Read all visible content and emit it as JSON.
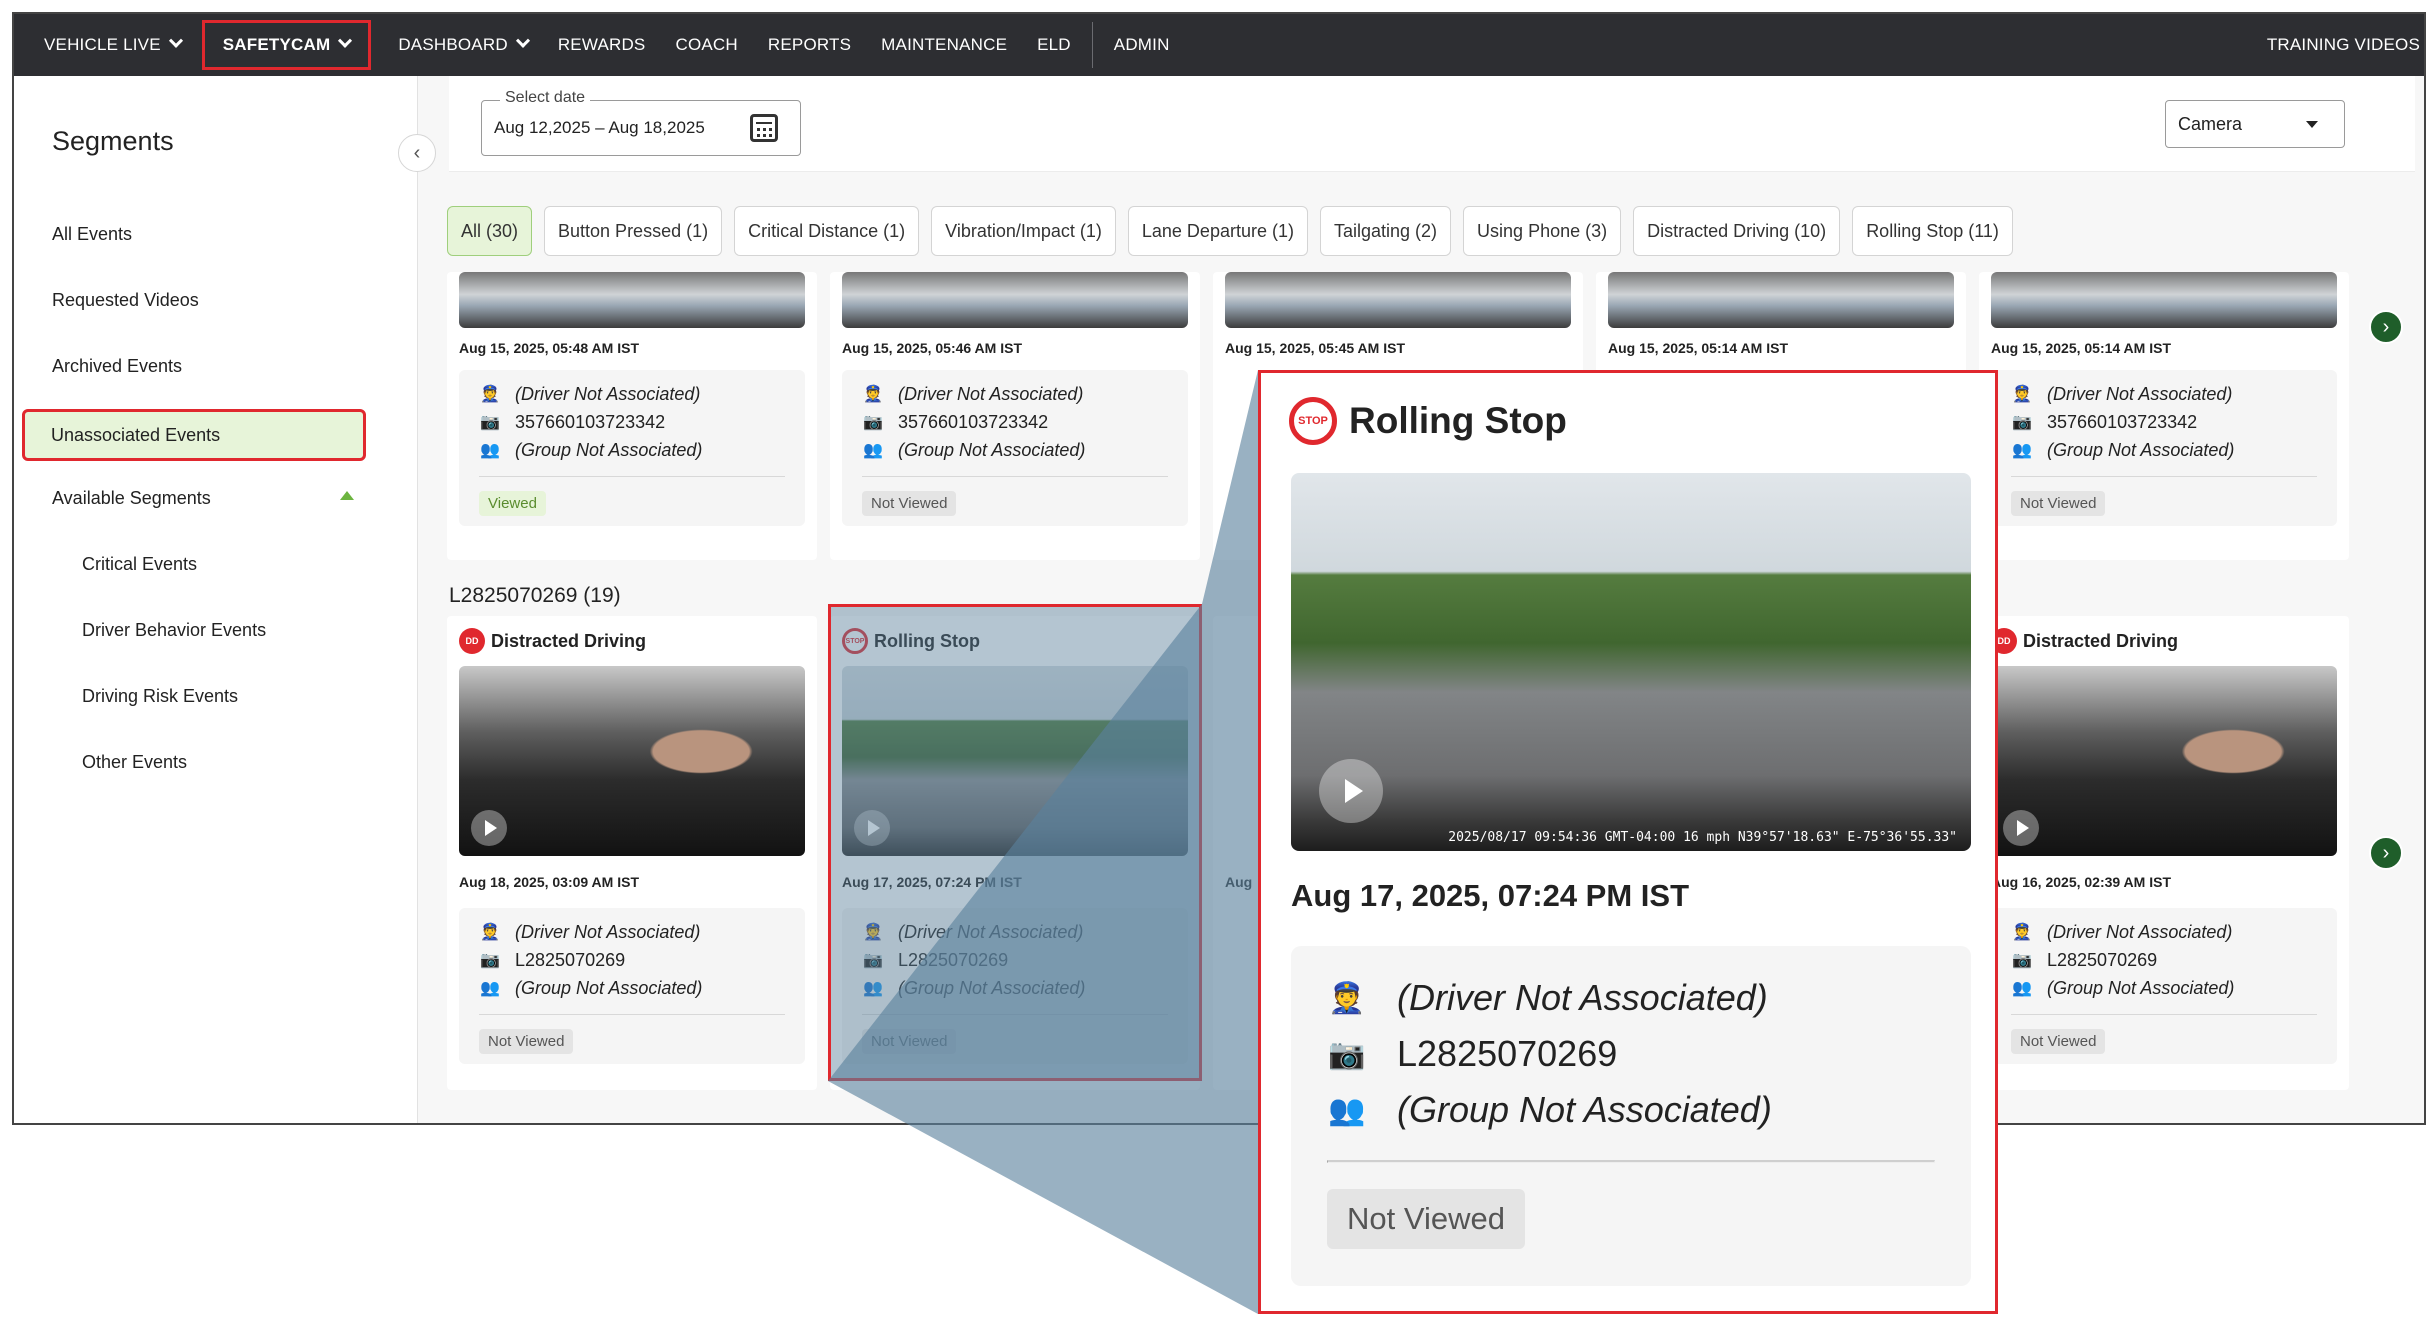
{
  "nav": {
    "items": [
      "VEHICLE LIVE",
      "SAFETYCAM",
      "DASHBOARD",
      "REWARDS",
      "COACH",
      "REPORTS",
      "MAINTENANCE",
      "ELD",
      "ADMIN"
    ],
    "right": "TRAINING VIDEOS"
  },
  "sidebar": {
    "title": "Segments",
    "items": [
      "All Events",
      "Requested Videos",
      "Archived Events",
      "Unassociated Events",
      "Available Segments"
    ],
    "subitems": [
      "Critical Events",
      "Driver Behavior Events",
      "Driving Risk Events",
      "Other Events"
    ]
  },
  "date": {
    "legend": "Select date",
    "value": "Aug 12,2025 – Aug 18,2025"
  },
  "camera": {
    "value": "Camera"
  },
  "filters": [
    "All (30)",
    "Button Pressed (1)",
    "Critical Distance (1)",
    "Vibration/Impact (1)",
    "Lane Departure (1)",
    "Tailgating (2)",
    "Using Phone (3)",
    "Distracted Driving (10)",
    "Rolling Stop (11)"
  ],
  "row1": [
    {
      "ts": "Aug 15, 2025, 05:48 AM IST",
      "driver": "(Driver Not Associated)",
      "device": "357660103723342",
      "group": "(Group Not Associated)",
      "status": "Viewed"
    },
    {
      "ts": "Aug 15, 2025, 05:46 AM IST",
      "driver": "(Driver Not Associated)",
      "device": "357660103723342",
      "group": "(Group Not Associated)",
      "status": "Not Viewed"
    },
    {
      "ts": "Aug 15, 2025, 05:45 AM IST"
    },
    {
      "ts": "Aug 15, 2025, 05:14 AM IST"
    },
    {
      "ts": "Aug 15, 2025, 05:14 AM IST",
      "driver": "(Driver Not Associated)",
      "device": "357660103723342",
      "group": "(Group Not Associated)",
      "status": "Not Viewed"
    }
  ],
  "group_label": "L2825070269 (19)",
  "row2": [
    {
      "title": "Distracted Driving",
      "ts": "Aug 18, 2025, 03:09 AM IST",
      "driver": "(Driver Not Associated)",
      "device": "L2825070269",
      "group": "(Group Not Associated)",
      "status": "Not Viewed"
    },
    {
      "title": "Rolling Stop",
      "ts": "Aug 17, 2025, 07:24 PM IST",
      "driver": "(Driver Not Associated)",
      "device": "L2825070269",
      "group": "(Group Not Associated)",
      "status": "Not Viewed",
      "overlay": "2025/08/17 09:54:36 GMT-04:00 16 mph N39°57'18.63\" E-75°36'55.33\""
    },
    {
      "ts": "Aug"
    },
    {
      "title": "Distracted Driving",
      "ts": "Aug 16, 2025, 02:39 AM IST",
      "driver": "(Driver Not Associated)",
      "device": "L2825070269",
      "group": "(Group Not Associated)",
      "status": "Not Viewed"
    }
  ],
  "icons": {
    "stop": "STOP",
    "distracted": "DD"
  },
  "colors": {
    "accent_red": "#e0282e",
    "selected_green": "#e7f4d9",
    "nav_bg": "#2d2e32",
    "next_btn": "#1f5e2a"
  }
}
